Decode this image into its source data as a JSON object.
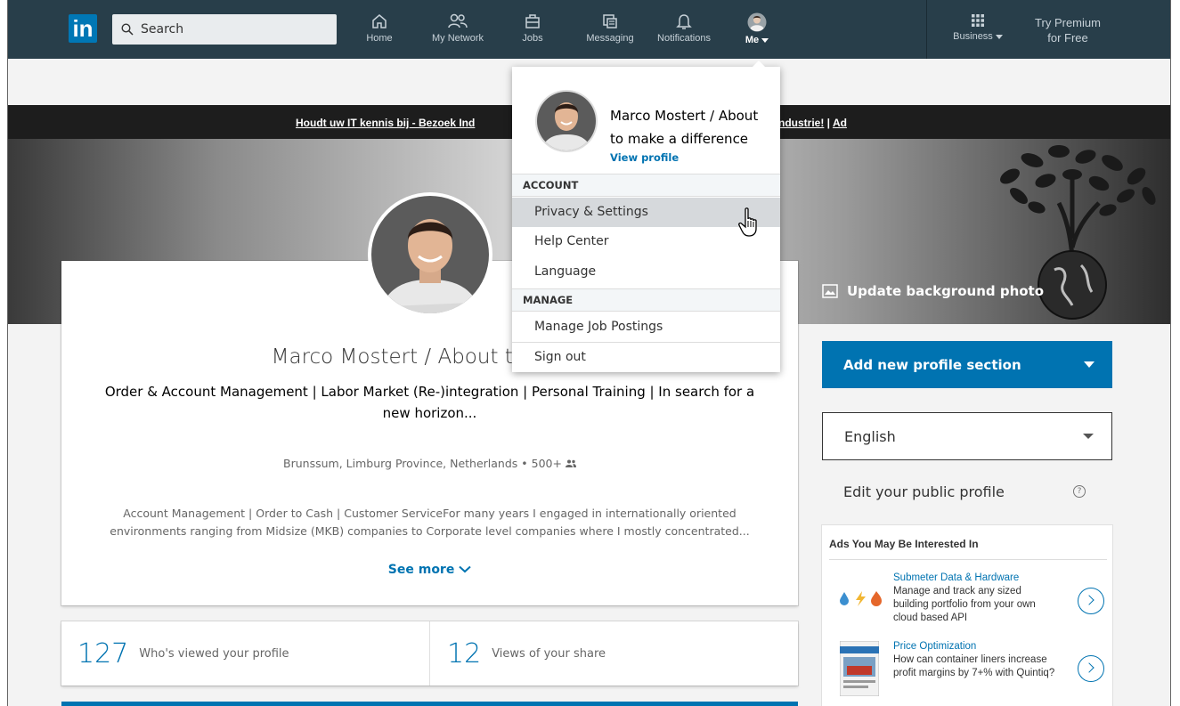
{
  "nav": {
    "logo": "in",
    "search_placeholder": "Search",
    "items": [
      {
        "label": "Home",
        "icon": "home-icon"
      },
      {
        "label": "My Network",
        "icon": "network-icon"
      },
      {
        "label": "Jobs",
        "icon": "briefcase-icon"
      },
      {
        "label": "Messaging",
        "icon": "messaging-icon"
      },
      {
        "label": "Notifications",
        "icon": "bell-icon"
      },
      {
        "label": "Me",
        "icon": "avatar"
      }
    ],
    "business": "Business",
    "premium_line1": "Try Premium",
    "premium_line2": "for Free"
  },
  "ad_banner": {
    "text_left": "Houdt uw IT kennis bij - Bezoek Ind",
    "text_right_link": "n industrie!",
    "text_right_sep": " | ",
    "text_right_ad": "Ad"
  },
  "profile": {
    "name": "Marco Mostert / About to make a difference",
    "name_visible": "Marco Mostert / About to make",
    "headline": "Order & Account Management | Labor Market (Re-)integration | Personal Training | In search for a new horizon...",
    "location": "Brunssum, Limburg Province, Netherlands",
    "connections": "500+",
    "summary": "Account Management | Order to Cash | Customer ServiceFor many years I engaged in internationally oriented environments ranging from Midsize (MKB) companies to Corporate level companies where I mostly concentrated...",
    "see_more": "See more",
    "update_background": "Update background photo"
  },
  "stats": [
    {
      "number": "127",
      "label": "Who's viewed your profile"
    },
    {
      "number": "12",
      "label": "Views of your share"
    }
  ],
  "right_rail": {
    "add_section": "Add new profile section",
    "language": "English",
    "edit_public": "Edit your public profile",
    "ads_title": "Ads You May Be Interested In",
    "ads": [
      {
        "title": "Submeter Data & Hardware",
        "body": "Manage and track any sized building portfolio from your own cloud based API"
      },
      {
        "title": "Price Optimization",
        "body": "How can container liners increase profit margins by 7+% with Quintiq?"
      }
    ]
  },
  "me_menu": {
    "name": "Marco Mostert / About to make a difference",
    "view_profile": "View profile",
    "account_header": "ACCOUNT",
    "account_items": [
      "Privacy & Settings",
      "Help Center",
      "Language"
    ],
    "manage_header": "MANAGE",
    "manage_items": [
      "Manage Job Postings"
    ],
    "sign_out": "Sign out",
    "highlighted": "Privacy & Settings"
  },
  "colors": {
    "nav_bg": "#283e4a",
    "brand_blue": "#0073b1",
    "menu_highlight": "#d6d9dc"
  }
}
